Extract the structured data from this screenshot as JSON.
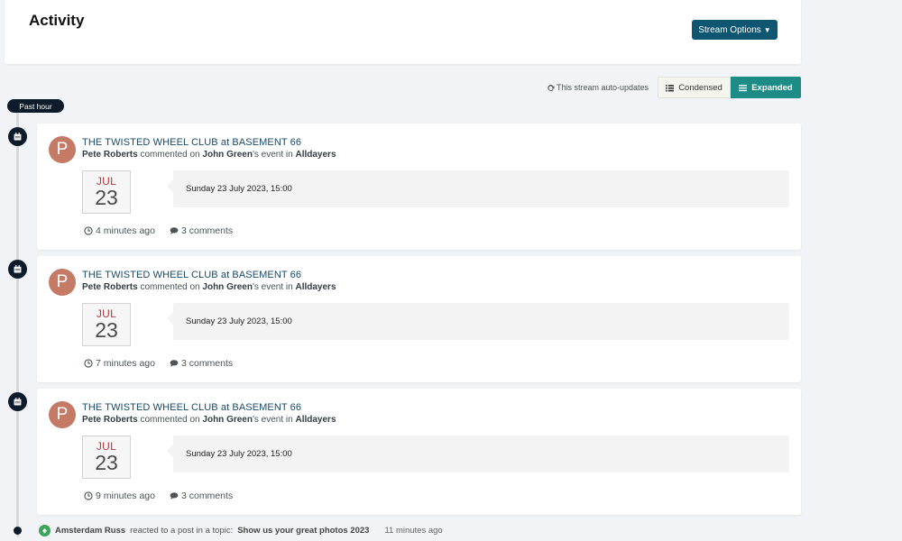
{
  "header": {
    "title": "Activity",
    "stream_options_label": "Stream Options"
  },
  "toolbar": {
    "auto_updates_text": "This stream auto-updates",
    "condensed_label": "Condensed",
    "expanded_label": "Expanded",
    "active_view": "Expanded"
  },
  "timeline": {
    "section_label": "Past hour"
  },
  "events": [
    {
      "avatar_letter": "P",
      "title": "THE TWISTED WHEEL CLUB at BASEMENT 66",
      "actor": "Pete Roberts",
      "action": "commented on",
      "owner": "John Green",
      "owner_suffix": "'s event in",
      "calendar": "Alldayers",
      "date_month": "JUL",
      "date_day": "23",
      "date_full": "Sunday 23 July 2023, 15:00",
      "time_ago": "4 minutes ago",
      "comments": "3 comments"
    },
    {
      "avatar_letter": "P",
      "title": "THE TWISTED WHEEL CLUB at BASEMENT 66",
      "actor": "Pete Roberts",
      "action": "commented on",
      "owner": "John Green",
      "owner_suffix": "'s event in",
      "calendar": "Alldayers",
      "date_month": "JUL",
      "date_day": "23",
      "date_full": "Sunday 23 July 2023, 15:00",
      "time_ago": "7 minutes ago",
      "comments": "3 comments"
    },
    {
      "avatar_letter": "P",
      "title": "THE TWISTED WHEEL CLUB at BASEMENT 66",
      "actor": "Pete Roberts",
      "action": "commented on",
      "owner": "John Green",
      "owner_suffix": "'s event in",
      "calendar": "Alldayers",
      "date_month": "JUL",
      "date_day": "23",
      "date_full": "Sunday 23 July 2023, 15:00",
      "time_ago": "9 minutes ago",
      "comments": "3 comments"
    }
  ],
  "condensed_item": {
    "actor": "Amsterdam Russ",
    "action": "reacted to a post in a topic:",
    "topic": "Show us your great photos 2023",
    "time_ago": "11 minutes ago"
  },
  "colors": {
    "primary_button": "#0f5672",
    "active_toggle": "#1d8c86",
    "timeline_marker": "#0d1b2b",
    "avatar": "#c57a66",
    "month_text": "#b5373f",
    "reaction_badge": "#3ba35b"
  }
}
